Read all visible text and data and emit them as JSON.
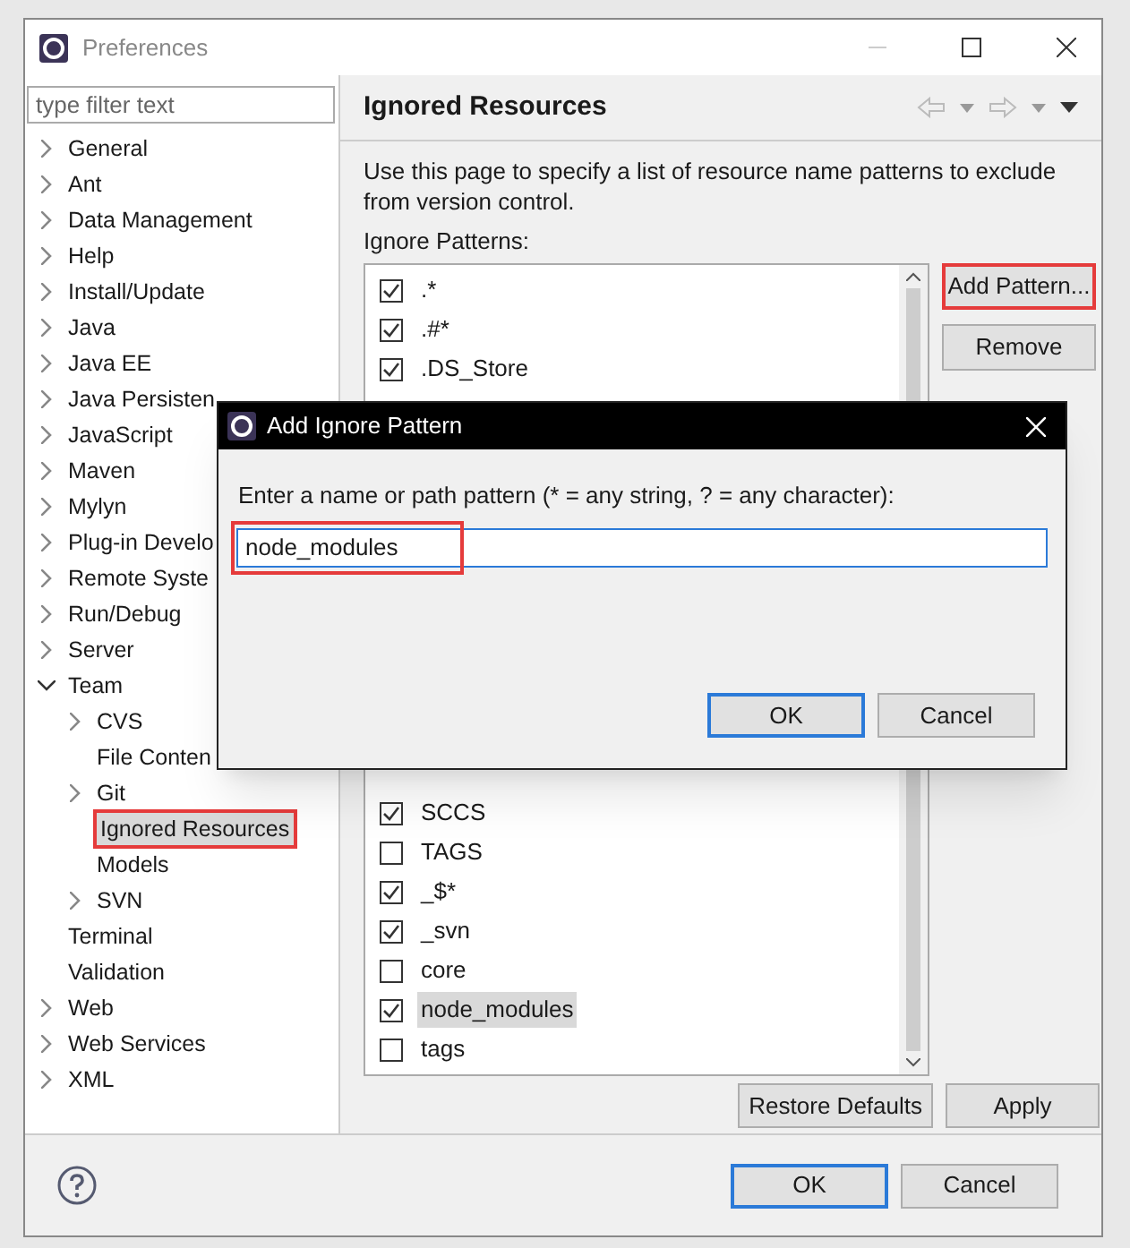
{
  "window": {
    "title": "Preferences"
  },
  "filter": {
    "placeholder": "type filter text"
  },
  "tree": [
    {
      "label": "General",
      "expanded": false,
      "selected": false
    },
    {
      "label": "Ant",
      "expanded": false,
      "selected": false
    },
    {
      "label": "Data Management",
      "expanded": false,
      "selected": false
    },
    {
      "label": "Help",
      "expanded": false,
      "selected": false
    },
    {
      "label": "Install/Update",
      "expanded": false,
      "selected": false
    },
    {
      "label": "Java",
      "expanded": false,
      "selected": false
    },
    {
      "label": "Java EE",
      "expanded": false,
      "selected": false
    },
    {
      "label": "Java Persisten",
      "expanded": false,
      "selected": false
    },
    {
      "label": "JavaScript",
      "expanded": false,
      "selected": false
    },
    {
      "label": "Maven",
      "expanded": false,
      "selected": false
    },
    {
      "label": "Mylyn",
      "expanded": false,
      "selected": false
    },
    {
      "label": "Plug-in Develo",
      "expanded": false,
      "selected": false
    },
    {
      "label": "Remote Syste",
      "expanded": false,
      "selected": false
    },
    {
      "label": "Run/Debug",
      "expanded": false,
      "selected": false
    },
    {
      "label": "Server",
      "expanded": false,
      "selected": false
    },
    {
      "label": "Team",
      "expanded": true,
      "selected": false,
      "children": [
        {
          "label": "CVS",
          "expanded": false,
          "selected": false
        },
        {
          "label": "File Conten",
          "selected": false
        },
        {
          "label": "Git",
          "expanded": false,
          "selected": false
        },
        {
          "label": "Ignored Resources",
          "selected": true
        },
        {
          "label": "Models",
          "selected": false
        },
        {
          "label": "SVN",
          "expanded": false,
          "selected": false
        }
      ]
    },
    {
      "label": "Terminal",
      "selected": false
    },
    {
      "label": "Validation",
      "selected": false
    },
    {
      "label": "Web",
      "expanded": false,
      "selected": false
    },
    {
      "label": "Web Services",
      "expanded": false,
      "selected": false
    },
    {
      "label": "XML",
      "expanded": false,
      "selected": false
    }
  ],
  "page": {
    "title": "Ignored Resources",
    "description": "Use this page to specify a list of resource name patterns to exclude from version control.",
    "list_label": "Ignore Patterns:"
  },
  "patterns_top": [
    {
      "label": ".*",
      "checked": true,
      "selected": false
    },
    {
      "label": ".#*",
      "checked": true,
      "selected": false
    },
    {
      "label": ".DS_Store",
      "checked": true,
      "selected": false
    }
  ],
  "patterns_bottom": [
    {
      "label": "SCCS",
      "checked": true,
      "selected": false
    },
    {
      "label": "TAGS",
      "checked": false,
      "selected": false
    },
    {
      "label": "_$*",
      "checked": true,
      "selected": false
    },
    {
      "label": "_svn",
      "checked": true,
      "selected": false
    },
    {
      "label": "core",
      "checked": false,
      "selected": false
    },
    {
      "label": "node_modules",
      "checked": true,
      "selected": true
    },
    {
      "label": "tags",
      "checked": false,
      "selected": false
    }
  ],
  "side_buttons": [
    {
      "label": "Add Pattern...",
      "highlighted": true
    },
    {
      "label": "Remove",
      "highlighted": false
    }
  ],
  "page_buttons": [
    "Restore Defaults",
    "Apply"
  ],
  "footer_buttons": [
    {
      "label": "OK",
      "default": true
    },
    {
      "label": "Cancel",
      "default": false
    }
  ],
  "dialog": {
    "title": "Add Ignore Pattern",
    "prompt": "Enter a name or path pattern (* = any string, ? = any character):",
    "value": "node_modules",
    "buttons": [
      {
        "label": "OK",
        "default": true
      },
      {
        "label": "Cancel",
        "default": false
      }
    ]
  }
}
